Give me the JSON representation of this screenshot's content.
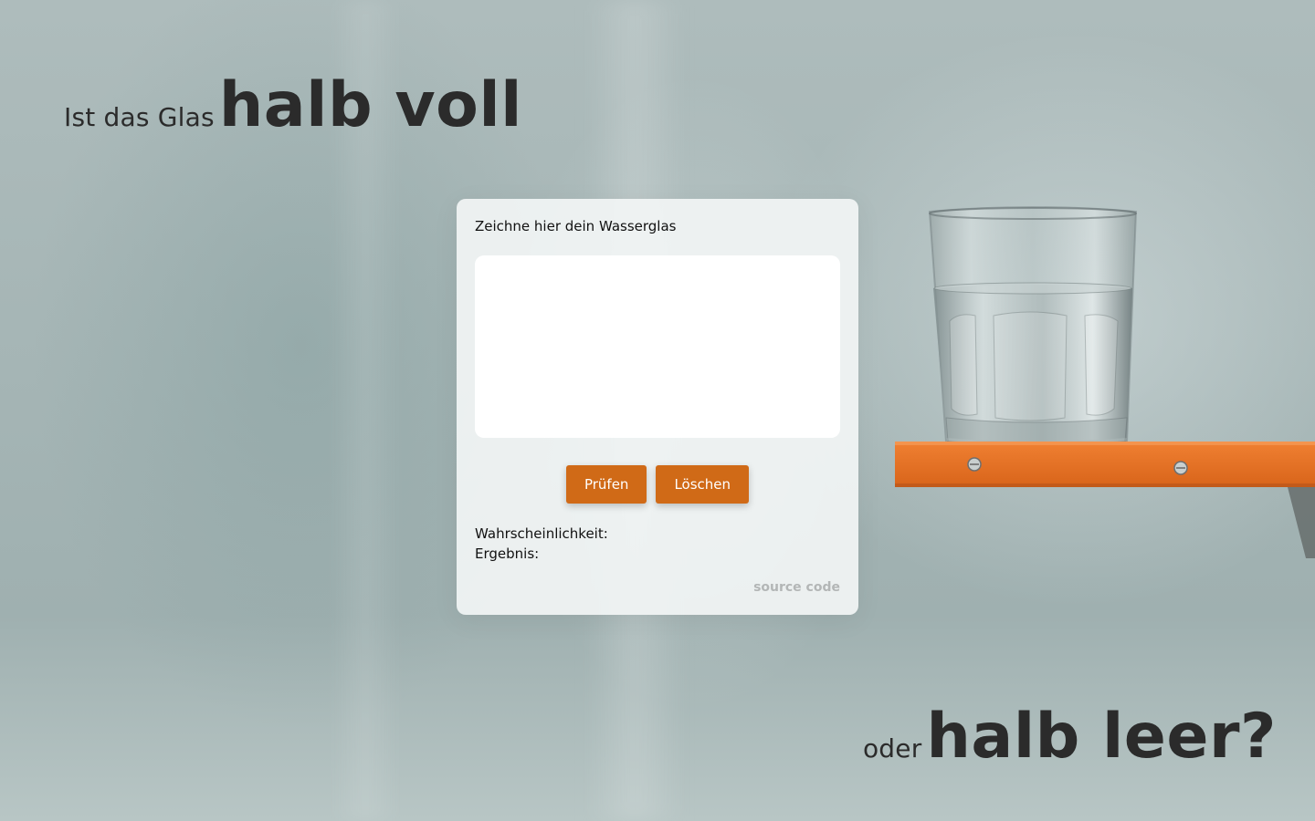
{
  "headline_top": {
    "small": "Ist das Glas",
    "big": "halb voll"
  },
  "headline_bottom": {
    "small": "oder",
    "big": "halb leer?"
  },
  "card": {
    "title": "Zeichne hier dein Wasserglas",
    "buttons": {
      "check_label": "Prüfen",
      "clear_label": "Löschen"
    },
    "probability_label": "Wahrscheinlichkeit:",
    "probability_value": "",
    "result_label": "Ergebnis:",
    "result_value": "",
    "source_link": "source code"
  },
  "colors": {
    "accent": "#d06a17",
    "shelf": "#e06d1f",
    "text": "#2b2b2b"
  },
  "photo": {
    "icon": "water-glass-on-shelf"
  }
}
